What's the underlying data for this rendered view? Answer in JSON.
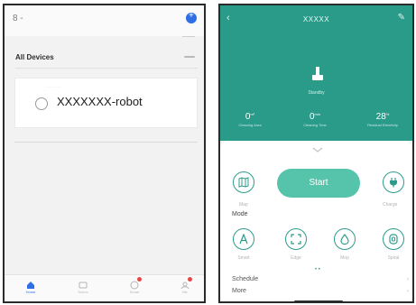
{
  "left_screen": {
    "user_label": "8 -",
    "section_title": "All Devices",
    "device_card": {
      "small_text": "· · · · · ·",
      "device_name": "XXXXXXX-robot"
    },
    "tabs": [
      {
        "label": "Home",
        "icon": "home-icon"
      },
      {
        "label": "Scene",
        "icon": "scene-icon"
      },
      {
        "label": "Smart",
        "icon": "smart-icon"
      },
      {
        "label": "Me",
        "icon": "me-icon"
      }
    ]
  },
  "right_screen": {
    "title": "XXXXX",
    "status": "Standby",
    "stats": [
      {
        "value": "0",
        "unit": "m²",
        "label": "Cleaning Area"
      },
      {
        "value": "0",
        "unit": "min",
        "label": "Cleaning Time"
      },
      {
        "value": "28",
        "unit": "%",
        "label": "Residual Electricity"
      }
    ],
    "actions": {
      "map_label": "Map",
      "start_label": "Start",
      "charge_label": "Charge"
    },
    "mode_title": "Mode",
    "modes": [
      {
        "label": "Smart",
        "icon": "letter-a-icon"
      },
      {
        "label": "Edge",
        "icon": "edge-icon"
      },
      {
        "label": "Mop",
        "icon": "water-drop-icon"
      },
      {
        "label": "Spiral",
        "icon": "spiral-icon"
      }
    ],
    "page_dots": "• •",
    "schedule_label": "Schedule",
    "more_label": "More"
  },
  "colors": {
    "teal_header": "#2a9a89",
    "start_button": "#56c4ab",
    "accent_blue": "#2f6fe6",
    "badge_red": "#e54848"
  }
}
